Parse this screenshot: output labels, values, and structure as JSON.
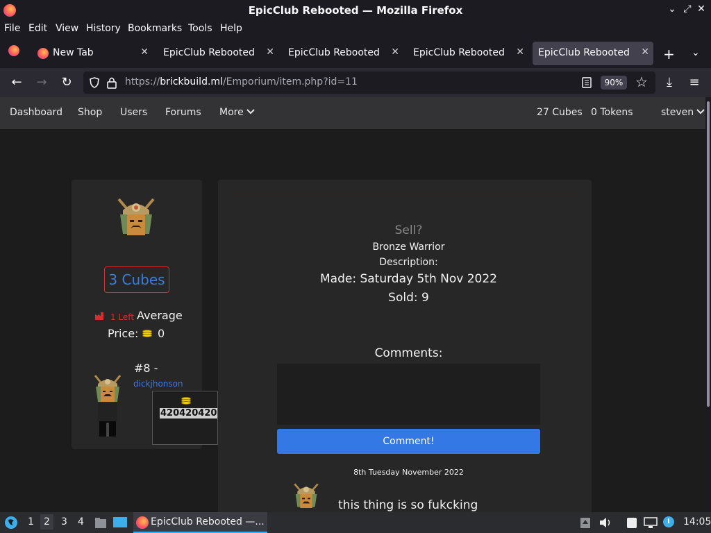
{
  "window": {
    "title": "EpicClub Rebooted — Mozilla Firefox"
  },
  "menu": {
    "file": "File",
    "edit": "Edit",
    "view": "View",
    "history": "History",
    "bookmarks": "Bookmarks",
    "tools": "Tools",
    "help": "Help"
  },
  "tabs": [
    {
      "label": "New Tab"
    },
    {
      "label": "EpicClub Rebooted"
    },
    {
      "label": "EpicClub Rebooted"
    },
    {
      "label": "EpicClub Rebooted"
    },
    {
      "label": "EpicClub Rebooted"
    }
  ],
  "urlbar": {
    "prefix": "https://",
    "domain": "brickbuild.ml",
    "path": "/Emporium/item.php?id=11",
    "zoom": "90%"
  },
  "sitenav": {
    "dashboard": "Dashboard",
    "shop": "Shop",
    "users": "Users",
    "forums": "Forums",
    "more": "More",
    "cubes": "27 Cubes",
    "tokens": "0 Tokens",
    "user": "steven"
  },
  "item": {
    "price": "3 Cubes",
    "left": "1 Left",
    "average_label": "Average",
    "price_label": "Price:",
    "average_price": "0",
    "seller_rank": "#8 -",
    "seller_name": "dickjhonson",
    "seller_price": "420420420",
    "sell": "Sell?",
    "name": "Bronze Warrior",
    "description_label": "Description:",
    "made": "Made: Saturday 5th Nov 2022",
    "sold": "Sold: 9",
    "comments_label": "Comments:",
    "comment_button": "Comment!",
    "comment_date": "8th Tuesday November 2022",
    "comment_text": "this thing is so fukcking"
  },
  "taskbar": {
    "ws1": "1",
    "ws2": "2",
    "ws3": "3",
    "ws4": "4",
    "window": "EpicClub Rebooted —...",
    "clock": "14:05"
  },
  "colors": {
    "accent": "#3478e5",
    "link": "#3b7ddd",
    "danger": "#d32f2f",
    "coin": "#f2d200"
  }
}
